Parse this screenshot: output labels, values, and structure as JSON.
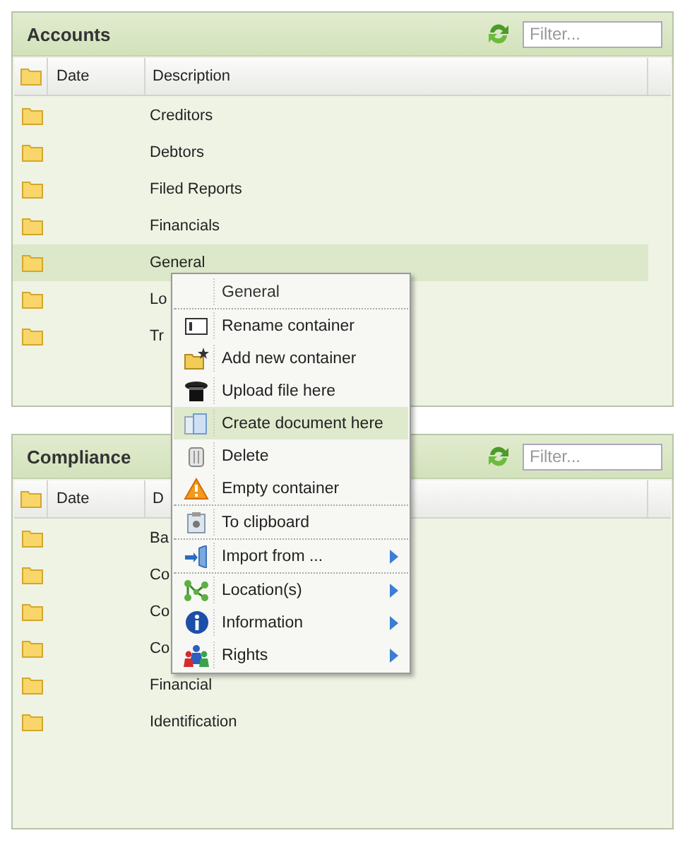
{
  "panels": [
    {
      "title": "Accounts",
      "filter": {
        "placeholder": "Filter..."
      },
      "columns": [
        "Date",
        "Description"
      ],
      "rows": [
        {
          "description": "Creditors",
          "selected": false
        },
        {
          "description": "Debtors",
          "selected": false
        },
        {
          "description": "Filed Reports",
          "selected": false
        },
        {
          "description": "Financials",
          "selected": false
        },
        {
          "description": "General",
          "selected": true
        },
        {
          "description": "Lo",
          "selected": false
        },
        {
          "description": "Tr",
          "selected": false
        }
      ]
    },
    {
      "title": "Compliance",
      "filter": {
        "placeholder": "Filter..."
      },
      "columns": [
        "Date",
        "D"
      ],
      "rows": [
        {
          "description": "Ba",
          "selected": false
        },
        {
          "description": "Co",
          "selected": false
        },
        {
          "description": "Co",
          "selected": false
        },
        {
          "description": "Co",
          "selected": false
        },
        {
          "description": "Financial",
          "selected": false
        },
        {
          "description": "Identification",
          "selected": false
        }
      ]
    }
  ],
  "context_menu": {
    "items": [
      {
        "kind": "title",
        "label": "General",
        "selected": false,
        "submenu": false,
        "separator_after": true
      },
      {
        "kind": "command",
        "label": "Rename container",
        "selected": false,
        "submenu": false,
        "separator_after": false
      },
      {
        "kind": "command",
        "label": "Add new container",
        "selected": false,
        "submenu": false,
        "separator_after": false
      },
      {
        "kind": "command",
        "label": "Upload file here",
        "selected": false,
        "submenu": false,
        "separator_after": false
      },
      {
        "kind": "command",
        "label": "Create document here",
        "selected": true,
        "submenu": false,
        "separator_after": false
      },
      {
        "kind": "command",
        "label": "Delete",
        "selected": false,
        "submenu": false,
        "separator_after": false
      },
      {
        "kind": "command",
        "label": "Empty container",
        "selected": false,
        "submenu": false,
        "separator_after": true
      },
      {
        "kind": "command",
        "label": "To clipboard",
        "selected": false,
        "submenu": false,
        "separator_after": true
      },
      {
        "kind": "command",
        "label": "Import from ...",
        "selected": false,
        "submenu": true,
        "separator_after": true
      },
      {
        "kind": "command",
        "label": "Location(s)",
        "selected": false,
        "submenu": true,
        "separator_after": false
      },
      {
        "kind": "command",
        "label": "Information",
        "selected": false,
        "submenu": true,
        "separator_after": false
      },
      {
        "kind": "command",
        "label": "Rights",
        "selected": false,
        "submenu": true,
        "separator_after": false
      }
    ]
  }
}
